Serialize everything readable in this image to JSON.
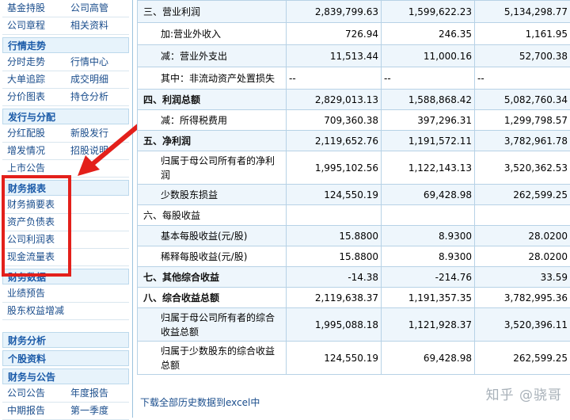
{
  "sidebar": {
    "rows_top": [
      {
        "left": "基金持股",
        "right": "公司高管"
      },
      {
        "left": "公司章程",
        "right": "相关资料"
      }
    ],
    "section_market": "行情走势",
    "rows_market": [
      {
        "left": "分时走势",
        "right": "行情中心"
      },
      {
        "left": "大单追踪",
        "right": "成交明细"
      },
      {
        "left": "分价图表",
        "right": "持仓分析"
      }
    ],
    "section_issue": "发行与分配",
    "rows_issue": [
      {
        "left": "分红配股",
        "right": "新股发行"
      },
      {
        "left": "增发情况",
        "right": "招股说明"
      },
      {
        "left": "上市公告",
        "right": ""
      }
    ],
    "section_reports": "财务报表",
    "rows_reports": [
      "财务摘要表",
      "资产负债表",
      "公司利润表",
      "现金流量表"
    ],
    "section_findata": "财务数据",
    "rows_findata": [
      "业绩预告",
      "股东权益增减"
    ],
    "section_analysis": "财务分析",
    "section_stock": "个股资料",
    "section_fin_announce": "财务与公告",
    "rows_bottom": [
      {
        "left": "公司公告",
        "right": "年度报告"
      },
      {
        "left": "中期报告",
        "right": "第一季度"
      }
    ]
  },
  "table": {
    "rows": [
      {
        "label": "三、营业利润",
        "style": "top",
        "c1": "2,839,799.63",
        "c2": "1,599,622.23",
        "c3": "5,134,298.77"
      },
      {
        "label": "加:营业外收入",
        "style": "indent",
        "c1": "726.94",
        "c2": "246.35",
        "c3": "1,161.95"
      },
      {
        "label": "减：营业外支出",
        "style": "indent",
        "c1": "11,513.44",
        "c2": "11,000.16",
        "c3": "52,700.38"
      },
      {
        "label": "其中：非流动资产处置损失",
        "style": "indent",
        "c1": "--",
        "c2": "--",
        "c3": "--"
      },
      {
        "label": "四、利润总额",
        "style": "bold",
        "c1": "2,829,013.13",
        "c2": "1,588,868.42",
        "c3": "5,082,760.34"
      },
      {
        "label": "减：所得税费用",
        "style": "indent",
        "c1": "709,360.38",
        "c2": "397,296.31",
        "c3": "1,299,798.57"
      },
      {
        "label": "五、净利润",
        "style": "bold",
        "c1": "2,119,652.76",
        "c2": "1,191,572.11",
        "c3": "3,782,961.78"
      },
      {
        "label": "归属于母公司所有者的净利润",
        "style": "wrap",
        "c1": "1,995,102.56",
        "c2": "1,122,143.13",
        "c3": "3,520,362.53"
      },
      {
        "label": "少数股东损益",
        "style": "indent",
        "c1": "124,550.19",
        "c2": "69,428.98",
        "c3": "262,599.25"
      },
      {
        "label": "六、每股收益",
        "style": "top",
        "c1": "",
        "c2": "",
        "c3": ""
      },
      {
        "label": "基本每股收益(元/股)",
        "style": "indent",
        "c1": "15.8800",
        "c2": "8.9300",
        "c3": "28.0200"
      },
      {
        "label": "稀释每股收益(元/股)",
        "style": "indent",
        "c1": "15.8800",
        "c2": "8.9300",
        "c3": "28.0200"
      },
      {
        "label": "七、其他综合收益",
        "style": "bold",
        "c1": "-14.38",
        "c2": "-214.76",
        "c3": "33.59"
      },
      {
        "label": "八、综合收益总额",
        "style": "bold",
        "c1": "2,119,638.37",
        "c2": "1,191,357.35",
        "c3": "3,782,995.36"
      },
      {
        "label": "归属于母公司所有者的综合收益总额",
        "style": "wrap",
        "c1": "1,995,088.18",
        "c2": "1,121,928.37",
        "c3": "3,520,396.11"
      },
      {
        "label": "归属于少数股东的综合收益总额",
        "style": "wrap",
        "c1": "124,550.19",
        "c2": "69,428.98",
        "c3": "262,599.25"
      }
    ],
    "download_text": "下载全部历史数据到excel中"
  },
  "watermark": "知乎 @骁哥",
  "colors": {
    "highlight_box": "#e3201b",
    "section_text": "#1a5aa8",
    "link_text": "#1a4d8c"
  }
}
